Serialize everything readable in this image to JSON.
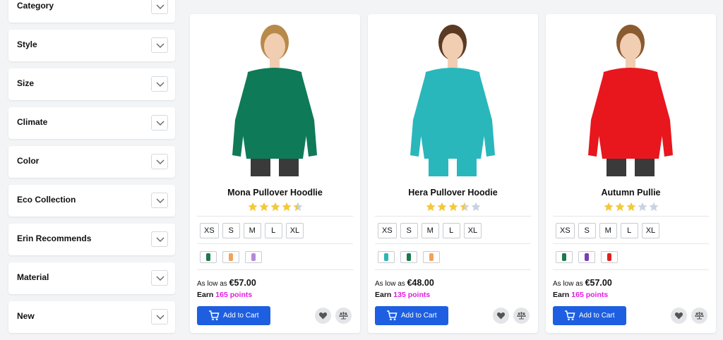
{
  "filters": {
    "items": [
      {
        "label": "Category"
      },
      {
        "label": "Style"
      },
      {
        "label": "Size"
      },
      {
        "label": "Climate"
      },
      {
        "label": "Color"
      },
      {
        "label": "Eco Collection"
      },
      {
        "label": "Erin Recommends"
      },
      {
        "label": "Material"
      },
      {
        "label": "New"
      }
    ]
  },
  "products": [
    {
      "name": "Mona Pullover Hoodlie",
      "rating_stars": 4.5,
      "sizes": [
        "XS",
        "S",
        "M",
        "L",
        "XL"
      ],
      "swatch_colors": [
        "#1a7a4c",
        "#f0a35c",
        "#b48ad6"
      ],
      "garment_color": "#0f7a57",
      "price_prefix": "As low as",
      "price": "€57.00",
      "earn_label": "Earn",
      "points": "165 points",
      "add_to_cart": "Add to Cart"
    },
    {
      "name": "Hera Pullover Hoodie",
      "rating_stars": 3.5,
      "sizes": [
        "XS",
        "S",
        "M",
        "L",
        "XL"
      ],
      "swatch_colors": [
        "#2bb7b4",
        "#1a7a4c",
        "#f0a35c"
      ],
      "garment_color": "#2ab7bb",
      "price_prefix": "As low as",
      "price": "€48.00",
      "earn_label": "Earn",
      "points": "135 points",
      "add_to_cart": "Add to Cart"
    },
    {
      "name": "Autumn Pullie",
      "rating_stars": 3,
      "sizes": [
        "XS",
        "S",
        "M",
        "L",
        "XL"
      ],
      "swatch_colors": [
        "#1a7a4c",
        "#7a3fb0",
        "#e02020"
      ],
      "garment_color": "#e8171d",
      "price_prefix": "As low as",
      "price": "€57.00",
      "earn_label": "Earn",
      "points": "165 points",
      "add_to_cart": "Add to Cart"
    }
  ],
  "colors": {
    "accent": "#1d5fe0",
    "points": "#e21be3",
    "star_filled": "#f3c93b",
    "star_empty": "#c9d3e2"
  }
}
